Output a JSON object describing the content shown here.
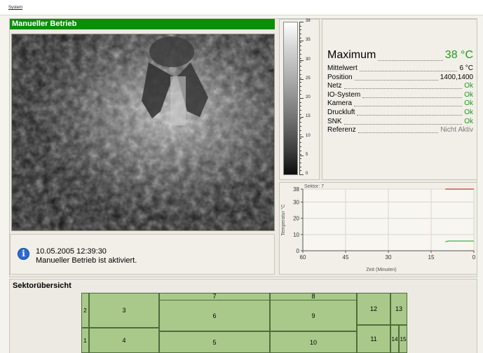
{
  "menu": {
    "system_label": "System"
  },
  "mode_title": "Manueller Betrieb",
  "message": {
    "icon": "info-icon",
    "date": "10.05.2005 12:39:30",
    "text": "Manueller Betrieb ist aktiviert."
  },
  "scale": {
    "labels": [
      "38",
      "35",
      "30",
      "25",
      "20",
      "15",
      "10",
      "5",
      "0"
    ]
  },
  "status": {
    "maximum": {
      "label": "Maximum",
      "value": "38 °C"
    },
    "rows": [
      {
        "label": "Mittelwert",
        "value": "6 °C",
        "state": "plain"
      },
      {
        "label": "Position",
        "value": "1400,1400",
        "state": "plain"
      },
      {
        "label": "Netz",
        "value": "Ok",
        "state": "ok"
      },
      {
        "label": "IO-System",
        "value": "Ok",
        "state": "ok"
      },
      {
        "label": "Kamera",
        "value": "Ok",
        "state": "ok"
      },
      {
        "label": "Druckluft",
        "value": "Ok",
        "state": "ok"
      },
      {
        "label": "SNK",
        "value": "Ok",
        "state": "ok"
      },
      {
        "label": "Referenz",
        "value": "Nicht Aktiv",
        "state": "gray"
      }
    ]
  },
  "chart_data": {
    "type": "line",
    "title": "Sektor: 7",
    "xlabel": "Zeit (Minuten)",
    "ylabel": "Temperatur °C",
    "x_ticks": [
      "60",
      "45",
      "30",
      "15",
      "0"
    ],
    "y_ticks": [
      "0",
      "10",
      "20",
      "30",
      "38"
    ],
    "xlim": [
      60,
      0
    ],
    "ylim": [
      0,
      38
    ],
    "grid": true,
    "series": [
      {
        "color": "#c0392b",
        "x": [
          10,
          0
        ],
        "y": [
          38,
          38
        ]
      },
      {
        "color": "#3bb54a",
        "x": [
          10,
          9,
          0
        ],
        "y": [
          5.5,
          6,
          6
        ]
      }
    ]
  },
  "sectors": {
    "title": "Sektorübersicht",
    "labels": [
      "1",
      "2",
      "3",
      "4",
      "5",
      "6",
      "7",
      "8",
      "9",
      "10",
      "11",
      "12",
      "13",
      "14",
      "15"
    ]
  },
  "colors": {
    "title_bar": "#0a8f07",
    "ok": "#1f9b1a",
    "sector_fill": "#a9c98a"
  }
}
